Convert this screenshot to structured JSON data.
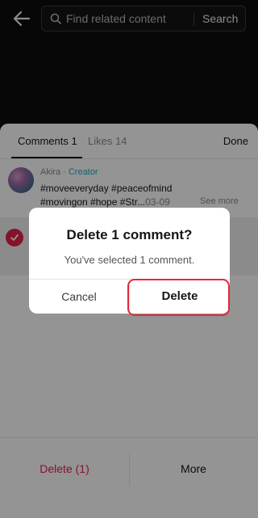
{
  "header": {
    "back_icon": "arrow-left-icon",
    "search_icon": "search-icon",
    "search_placeholder": "Find related content",
    "search_label": "Search"
  },
  "sheet": {
    "tabs": [
      {
        "label": "Comments 1",
        "active": true
      },
      {
        "label": "Likes 14",
        "active": false
      }
    ],
    "done_label": "Done",
    "comment": {
      "author": "Akira",
      "separator": " · ",
      "badge": "Creator",
      "text": "#moveeveryday #peaceofmind #movingon #hope #Str...",
      "date": "03-09",
      "see_more": "See more"
    },
    "actions": {
      "delete_label": "Delete (1)",
      "more_label": "More"
    }
  },
  "dialog": {
    "title": "Delete 1 comment?",
    "message": "You've selected 1 comment.",
    "cancel_label": "Cancel",
    "delete_label": "Delete"
  },
  "colors": {
    "accent_red": "#e2234a",
    "creator_teal": "#22a7c3",
    "highlight_outline": "#e12a3a"
  }
}
